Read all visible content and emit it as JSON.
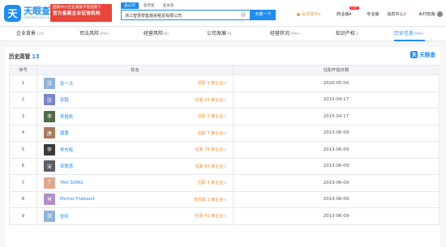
{
  "header": {
    "logo_mark": "天",
    "logo_name": "天眼查",
    "logo_url": "TianYanCha.com",
    "gov_badge_line1": "国家中小企业发展子基金旗下",
    "gov_badge_line2": "官方备案企业征信机构",
    "search_tabs": [
      "查公司",
      "查老板",
      "查关系"
    ],
    "search_value": "浙江智慧零售融资租赁有限公司",
    "search_button": "天眼一下",
    "nav": {
      "vip": "会员服务",
      "biz": "商业版",
      "hot": "HOT",
      "pro": "专业版",
      "msg": "消息中心",
      "msg_count": "2",
      "user": "木村拓哉"
    }
  },
  "dim_tabs": [
    {
      "label": "企业背景",
      "count": "120"
    },
    {
      "label": "司法风险",
      "count": "999+"
    },
    {
      "label": "经营风险",
      "count": "80"
    },
    {
      "label": "公司发展",
      "count": "91"
    },
    {
      "label": "经营状况",
      "count": "999+"
    },
    {
      "label": "知识产权",
      "count": "3"
    },
    {
      "label": "历史信息",
      "count": "999+"
    }
  ],
  "section": {
    "title": "历史高管",
    "count": "13",
    "watermark": "天眼查"
  },
  "table": {
    "headers": [
      "序号",
      "姓名",
      "任职开始日期"
    ],
    "rows": [
      {
        "idx": "1",
        "avatar": "张",
        "avatar_color": "#8fb3d9",
        "name": "张一凡",
        "role": "任职 1 家企业",
        "date": "2020-05-04"
      },
      {
        "idx": "2",
        "avatar": "张",
        "avatar_color": "#7c86c7",
        "name": "张毅",
        "role": "任职 25 家企业",
        "date": "2015-04-17"
      },
      {
        "idx": "3",
        "avatar": "李",
        "avatar_color": "#4d6b45",
        "name": "李轶凯",
        "role": "任职 2 家企业",
        "date": "2015-04-17"
      },
      {
        "idx": "4",
        "avatar": "唐",
        "avatar_color": "#a87b5e",
        "name": "唐蕾",
        "role": "任职 7 家企业",
        "date": "2013-06-09"
      },
      {
        "idx": "5",
        "avatar": "李",
        "avatar_color": "#3a3a3a",
        "name": "李东辉",
        "role": "任职 76 家企业",
        "date": "2013-06-09"
      },
      {
        "idx": "6",
        "avatar": "宋",
        "avatar_color": "#5c5c66",
        "name": "宋聪慧",
        "role": "任职 80 家企业",
        "date": "2013-06-09"
      },
      {
        "idx": "7",
        "avatar": "T",
        "avatar_color": "#e0a88f",
        "name": "TAO SONG",
        "role": "任职 3 家企业",
        "date": "2013-06-09"
      },
      {
        "idx": "8",
        "avatar": "M",
        "avatar_color": "#b28fc7",
        "name": "Michel Thebault",
        "role": "曾任职 1 家企业",
        "date": "2013-06-09"
      },
      {
        "idx": "9",
        "avatar": "张",
        "avatar_color": "#8fb3d9",
        "name": "张权",
        "role": "任职 41 家企业",
        "date": "2013-06-09"
      }
    ]
  }
}
